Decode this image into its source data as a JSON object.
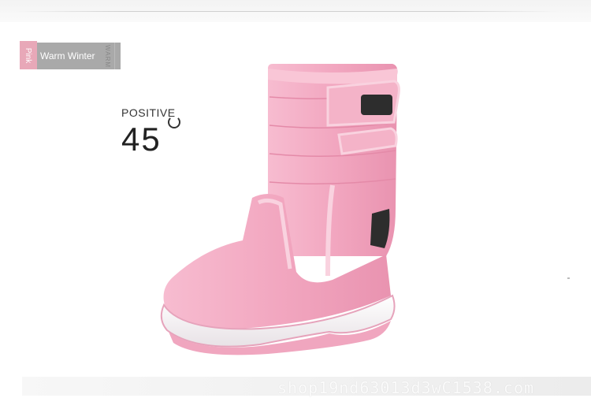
{
  "tag": {
    "color_text": "Pink",
    "name_text": "Warm Winter",
    "side_text": "WARM"
  },
  "angle": {
    "label": "POSITIVE",
    "value": "45"
  },
  "product": {
    "image_icon": "pink-snow-boot-icon",
    "colors": {
      "upper": "#f2a9c0",
      "sole": "#f5f0f2",
      "accent": "#2d2d2d"
    }
  },
  "watermark": {
    "text": "shop19nd63013d3wC1538.com"
  }
}
